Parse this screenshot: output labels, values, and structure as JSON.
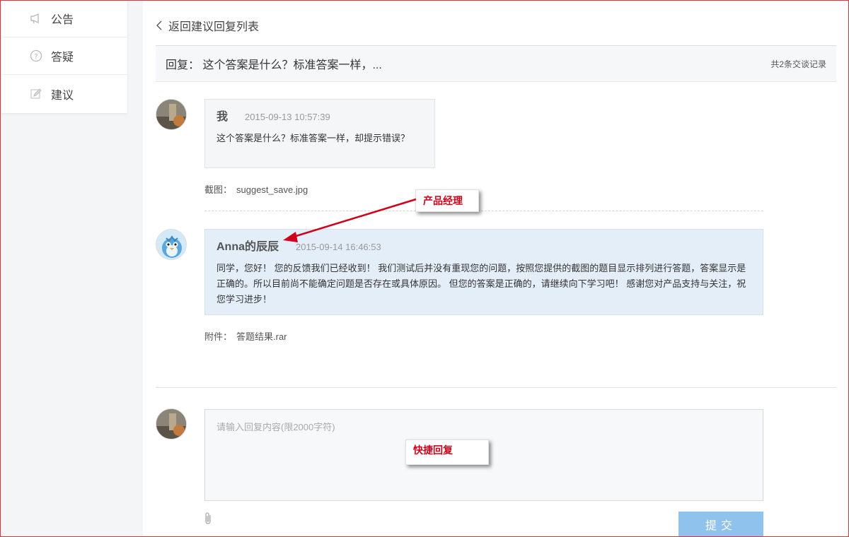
{
  "sidebar": {
    "items": [
      {
        "label": "公告",
        "icon": "megaphone-icon"
      },
      {
        "label": "答疑",
        "icon": "question-circle-icon"
      },
      {
        "label": "建议",
        "icon": "edit-icon"
      }
    ]
  },
  "header": {
    "back_label": "返回建议回复列表",
    "subject": "回复： 这个答案是什么？标准答案一样，...",
    "record_count": "共2条交谈记录"
  },
  "thread": [
    {
      "author": "我",
      "time": "2015-09-13 10:57:39",
      "text": "这个答案是什么？标准答案一样，却提示错误？",
      "attachment_label": "截图：",
      "attachment_file": "suggest_save.jpg"
    },
    {
      "author": "Anna的辰辰",
      "time": "2015-09-14 16:46:53",
      "text": "同学，您好！ 您的反馈我们已经收到！ 我们测试后并没有重现您的问题，按照您提供的截图的题目显示排列进行答题，答案显示是正确的。所以目前尚不能确定问题是否存在或具体原因。 但您的答案是正确的，请继续向下学习吧！ 感谢您对产品支持与关注，祝您学习进步！",
      "attachment_label": "附件：",
      "attachment_file": "答题结果.rar"
    }
  ],
  "reply": {
    "placeholder": "请输入回复内容(限2000字符)",
    "submit_label": "提交"
  },
  "annotations": {
    "product_manager": "产品经理",
    "quick_reply": "快捷回复"
  },
  "colors": {
    "accent_button": "#8fc2ec",
    "reply_bubble": "#e4eef9",
    "annotation_text": "#d0021b",
    "arrow": "#d0021b"
  }
}
